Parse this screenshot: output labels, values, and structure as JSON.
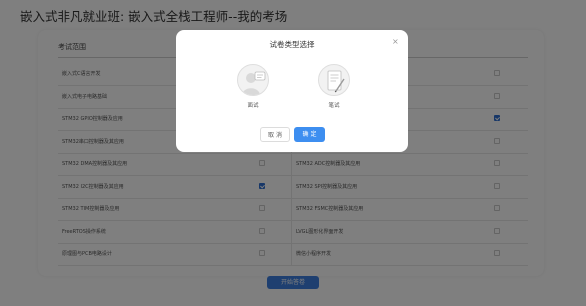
{
  "page": {
    "title": "嵌入式非凡就业班: 嵌入式全栈工程师--我的考场",
    "section_title": "考试范围",
    "start_button": "开始答卷",
    "topics": [
      {
        "left": {
          "label": "嵌入式C语言开发",
          "checked": false
        },
        "right": {
          "label": "",
          "checked": false
        }
      },
      {
        "left": {
          "label": "嵌入式电子电路基础",
          "checked": false
        },
        "right": {
          "label": "",
          "checked": false
        }
      },
      {
        "left": {
          "label": "STM32 GPIO控制器及应用",
          "checked": false
        },
        "right": {
          "label": "",
          "checked": true
        }
      },
      {
        "left": {
          "label": "STM32串口控制器及其应用",
          "checked": false
        },
        "right": {
          "label": "",
          "checked": false
        }
      },
      {
        "left": {
          "label": "STM32 DMA控制器及其应用",
          "checked": false
        },
        "right": {
          "label": "STM32 ADC控制器及其应用",
          "checked": false
        }
      },
      {
        "left": {
          "label": "STM32 I2C控制器及其应用",
          "checked": true
        },
        "right": {
          "label": "STM32 SPI控制器及其应用",
          "checked": false
        }
      },
      {
        "left": {
          "label": "STM32 TIM控制器及应用",
          "checked": false
        },
        "right": {
          "label": "STM32 FSMC控制器及其应用",
          "checked": false
        }
      },
      {
        "left": {
          "label": "FreeRTOS操作系统",
          "checked": false
        },
        "right": {
          "label": "LVGL图形化界面开发",
          "checked": false
        }
      },
      {
        "left": {
          "label": "原理图与PCB电路设计",
          "checked": false
        },
        "right": {
          "label": "微信小程序开发",
          "checked": false
        }
      }
    ]
  },
  "modal": {
    "title": "试卷类型选择",
    "close_glyph": "×",
    "options": [
      {
        "label": "面试",
        "icon": "interview-person-icon"
      },
      {
        "label": "笔试",
        "icon": "written-exam-paper-icon"
      }
    ],
    "cancel_label": "取 消",
    "confirm_label": "确 定"
  },
  "colors": {
    "primary": "#3d8ef0",
    "overlay": "rgba(0,0,0,0.5)",
    "checked": "#2f6fd0"
  }
}
